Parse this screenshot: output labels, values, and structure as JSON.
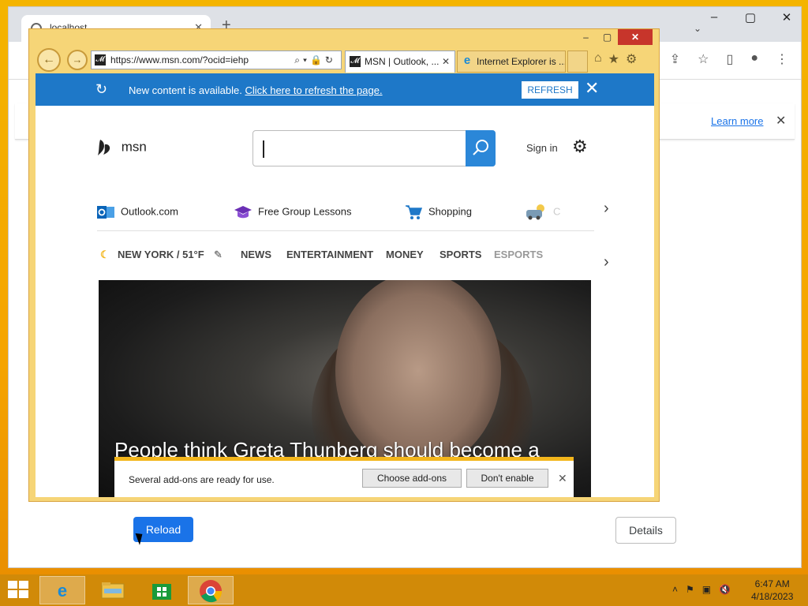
{
  "chrome": {
    "tab_title": "localhost",
    "tab_close": "✕",
    "new_tab": "+",
    "window_controls": [
      "–",
      "▢",
      "✕"
    ],
    "dropdown_icon": "⌄",
    "toolbar_icons": [
      "share-icon",
      "star-icon",
      "sidepanel-icon",
      "profile-icon",
      "menu-icon"
    ],
    "toolbar_glyphs": [
      "⇪",
      "☆",
      "▯",
      "●",
      "⋮"
    ],
    "learn_more": "Learn more",
    "infobar_close": "✕",
    "reload_label": "Reload",
    "details_label": "Details"
  },
  "ie": {
    "window_controls": [
      "–",
      "▢",
      "✕"
    ],
    "back": "←",
    "forward": "→",
    "url": "https://www.msn.com/?ocid=iehp",
    "url_icons": "⌕▾🔒↻",
    "tabs": [
      {
        "title": "MSN | Outlook, ...",
        "close": "✕"
      },
      {
        "title": "Internet Explorer is ..."
      }
    ],
    "toolbar": [
      "⌂",
      "★",
      "⚙"
    ]
  },
  "msn": {
    "refresh_bar": {
      "message": "New content is available.",
      "link": "Click here to refresh the page.",
      "button": "REFRESH",
      "close": "✕"
    },
    "logo_text": "msn",
    "sign_in": "Sign in",
    "quicklinks": [
      "Outlook.com",
      "Free Group Lessons",
      "Shopping",
      "C"
    ],
    "weather": "NEW YORK / 51°F",
    "nav": [
      "NEWS",
      "ENTERTAINMENT",
      "MONEY",
      "SPORTS",
      "ESPORTS"
    ],
    "hero_headline": "People think Greta Thunberg should become a",
    "notification": {
      "message": "Several add-ons are ready for use.",
      "choose": "Choose add-ons",
      "dont_enable": "Don't enable",
      "close": "✕"
    }
  },
  "taskbar": {
    "time": "6:47 AM",
    "date": "4/18/2023",
    "tray_icons": [
      "up-arrow-icon",
      "flag-icon",
      "network-icon",
      "volume-muted-icon"
    ]
  }
}
